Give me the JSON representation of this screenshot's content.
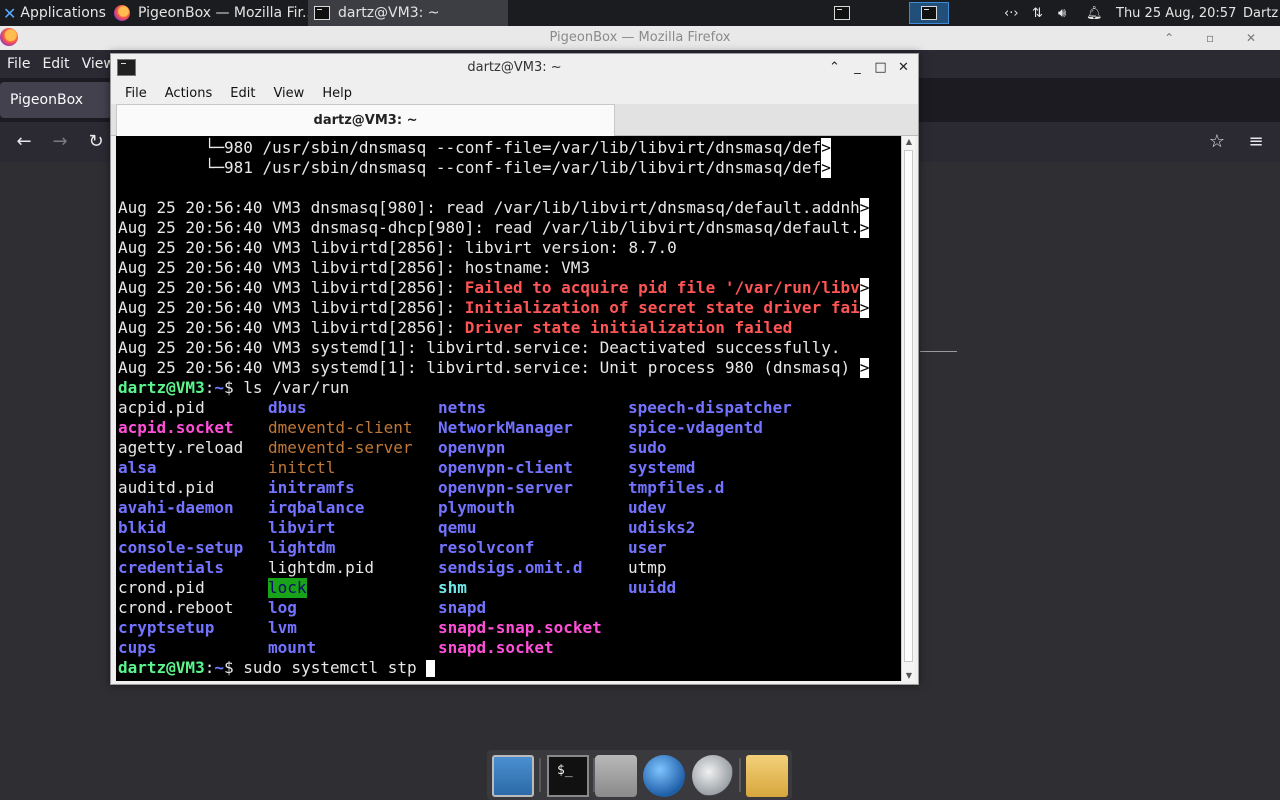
{
  "top_panel": {
    "applications_label": "Applications",
    "tasks": [
      {
        "label": "PigeonBox — Mozilla Fir...",
        "icon": "firefox-icon"
      },
      {
        "label": "dartz@VM3: ~",
        "icon": "terminal-icon"
      }
    ],
    "clock": "Thu 25 Aug, 20:57",
    "user": "Dartz"
  },
  "firefox": {
    "title": "PigeonBox — Mozilla Firefox",
    "menu": [
      "File",
      "Edit",
      "View"
    ],
    "tab_label": "PigeonBox"
  },
  "terminal": {
    "title": "dartz@VM3: ~",
    "menu": [
      "File",
      "Actions",
      "Edit",
      "View",
      "Help"
    ],
    "tab_label": "dartz@VM3: ~",
    "log_lines": [
      "         └─980 /usr/sbin/dnsmasq --conf-file=/var/lib/libvirt/dnsmasq/def",
      "         └─981 /usr/sbin/dnsmasq --conf-file=/var/lib/libvirt/dnsmasq/def",
      "",
      "Aug 25 20:56:40 VM3 dnsmasq[980]: read /var/lib/libvirt/dnsmasq/default.addnh",
      "Aug 25 20:56:40 VM3 dnsmasq-dhcp[980]: read /var/lib/libvirt/dnsmasq/default.",
      "Aug 25 20:56:40 VM3 libvirtd[2856]: libvirt version: 8.7.0",
      "Aug 25 20:56:40 VM3 libvirtd[2856]: hostname: VM3",
      "Aug 25 20:56:40 VM3 libvirtd[2856]: ",
      "Aug 25 20:56:40 VM3 libvirtd[2856]: ",
      "Aug 25 20:56:40 VM3 libvirtd[2856]: ",
      "Aug 25 20:56:40 VM3 systemd[1]: libvirtd.service: Deactivated successfully.",
      "Aug 25 20:56:40 VM3 systemd[1]: libvirtd.service: Unit process 980 (dnsmasq) "
    ],
    "error_texts": [
      "Failed to acquire pid file '/var/run/libv",
      "Initialization of secret state driver fai",
      "Driver state initialization failed"
    ],
    "truncation_marker": ">",
    "prompt_user": "dartz@VM3",
    "prompt_colon": ":",
    "prompt_path": "~",
    "prompt_sym": "$",
    "command1": " ls /var/run",
    "command2": " sudo systemctl stp ",
    "ls_columns": [
      [
        {
          "t": "acpid.pid",
          "k": "plain"
        },
        {
          "t": "acpid.socket",
          "k": "sock"
        },
        {
          "t": "agetty.reload",
          "k": "plain"
        },
        {
          "t": "alsa",
          "k": "dir"
        },
        {
          "t": "auditd.pid",
          "k": "plain"
        },
        {
          "t": "avahi-daemon",
          "k": "dir"
        },
        {
          "t": "blkid",
          "k": "dir"
        },
        {
          "t": "console-setup",
          "k": "dir"
        },
        {
          "t": "credentials",
          "k": "dir"
        },
        {
          "t": "crond.pid",
          "k": "plain"
        },
        {
          "t": "crond.reboot",
          "k": "plain"
        },
        {
          "t": "cryptsetup",
          "k": "dir"
        },
        {
          "t": "cups",
          "k": "dir"
        }
      ],
      [
        {
          "t": "dbus",
          "k": "dir"
        },
        {
          "t": "dmeventd-client",
          "k": "fifo"
        },
        {
          "t": "dmeventd-server",
          "k": "fifo"
        },
        {
          "t": "initctl",
          "k": "fifo"
        },
        {
          "t": "initramfs",
          "k": "dir"
        },
        {
          "t": "irqbalance",
          "k": "dir"
        },
        {
          "t": "libvirt",
          "k": "dir"
        },
        {
          "t": "lightdm",
          "k": "dir"
        },
        {
          "t": "lightdm.pid",
          "k": "plain"
        },
        {
          "t": "lock",
          "k": "lockbg"
        },
        {
          "t": "log",
          "k": "dir"
        },
        {
          "t": "lvm",
          "k": "dir"
        },
        {
          "t": "mount",
          "k": "dir"
        }
      ],
      [
        {
          "t": "netns",
          "k": "dir"
        },
        {
          "t": "NetworkManager",
          "k": "dir"
        },
        {
          "t": "openvpn",
          "k": "dir"
        },
        {
          "t": "openvpn-client",
          "k": "dir"
        },
        {
          "t": "openvpn-server",
          "k": "dir"
        },
        {
          "t": "plymouth",
          "k": "dir"
        },
        {
          "t": "qemu",
          "k": "dir"
        },
        {
          "t": "resolvconf",
          "k": "dir"
        },
        {
          "t": "sendsigs.omit.d",
          "k": "dir"
        },
        {
          "t": "shm",
          "k": "cyan"
        },
        {
          "t": "snapd",
          "k": "dir"
        },
        {
          "t": "snapd-snap.socket",
          "k": "sock"
        },
        {
          "t": "snapd.socket",
          "k": "sock"
        }
      ],
      [
        {
          "t": "speech-dispatcher",
          "k": "dir"
        },
        {
          "t": "spice-vdagentd",
          "k": "dir"
        },
        {
          "t": "sudo",
          "k": "dir"
        },
        {
          "t": "systemd",
          "k": "dir"
        },
        {
          "t": "tmpfiles.d",
          "k": "dir"
        },
        {
          "t": "udev",
          "k": "dir"
        },
        {
          "t": "udisks2",
          "k": "dir"
        },
        {
          "t": "user",
          "k": "dir"
        },
        {
          "t": "utmp",
          "k": "plain"
        },
        {
          "t": "uuidd",
          "k": "dir"
        }
      ]
    ]
  },
  "dock": {
    "items": [
      "show-desktop-icon",
      "terminal-icon",
      "home-folder-icon",
      "web-browser-icon",
      "search-icon",
      "file-manager-icon"
    ]
  }
}
